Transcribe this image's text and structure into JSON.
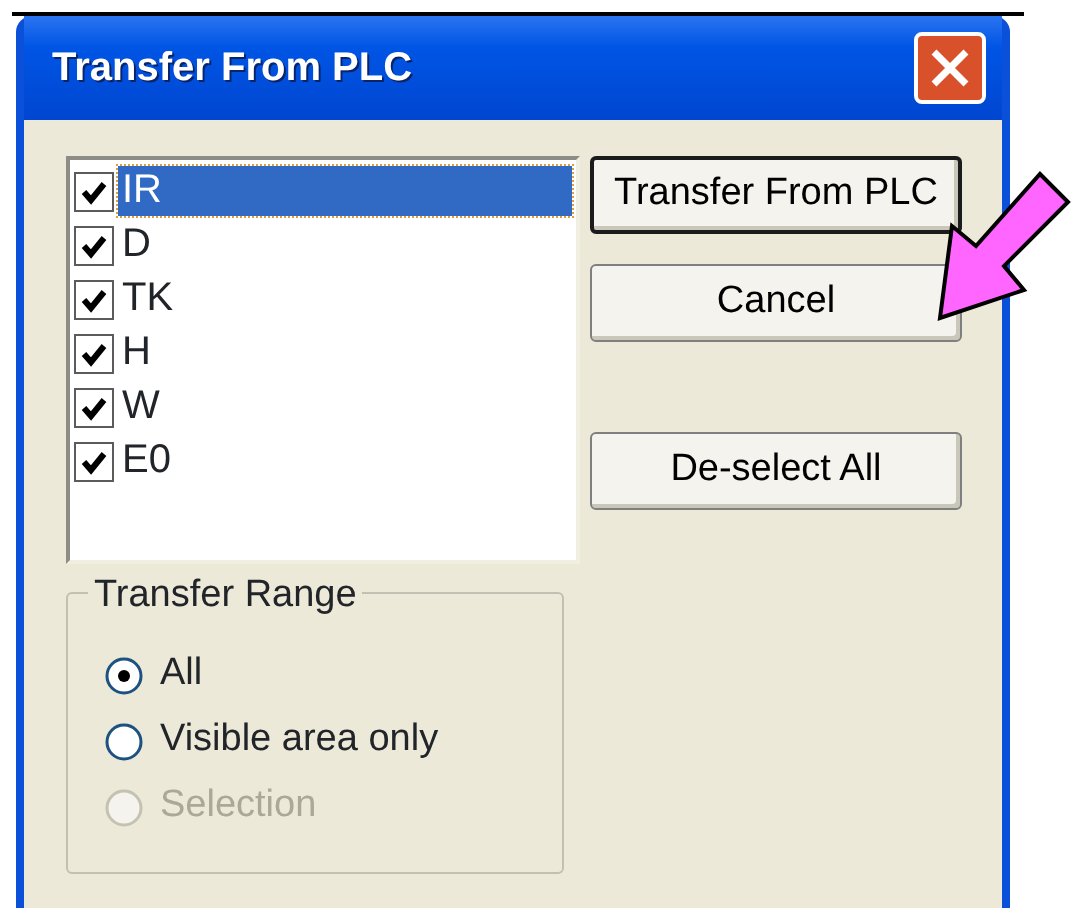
{
  "window": {
    "title": "Transfer From PLC"
  },
  "areas": [
    {
      "label": "IR",
      "checked": true,
      "selected": true
    },
    {
      "label": "D",
      "checked": true,
      "selected": false
    },
    {
      "label": "TK",
      "checked": true,
      "selected": false
    },
    {
      "label": "H",
      "checked": true,
      "selected": false
    },
    {
      "label": "W",
      "checked": true,
      "selected": false
    },
    {
      "label": "E0",
      "checked": true,
      "selected": false
    }
  ],
  "buttons": [
    {
      "label": "Transfer From PLC",
      "default": true
    },
    {
      "label": "Cancel",
      "default": false
    },
    {
      "label": "De-select All",
      "default": false
    }
  ],
  "transfer_range": {
    "title": "Transfer Range",
    "options": [
      {
        "label": "All",
        "selected": true,
        "disabled": false
      },
      {
        "label": "Visible area only",
        "selected": false,
        "disabled": false
      },
      {
        "label": "Selection",
        "selected": false,
        "disabled": true
      }
    ]
  }
}
